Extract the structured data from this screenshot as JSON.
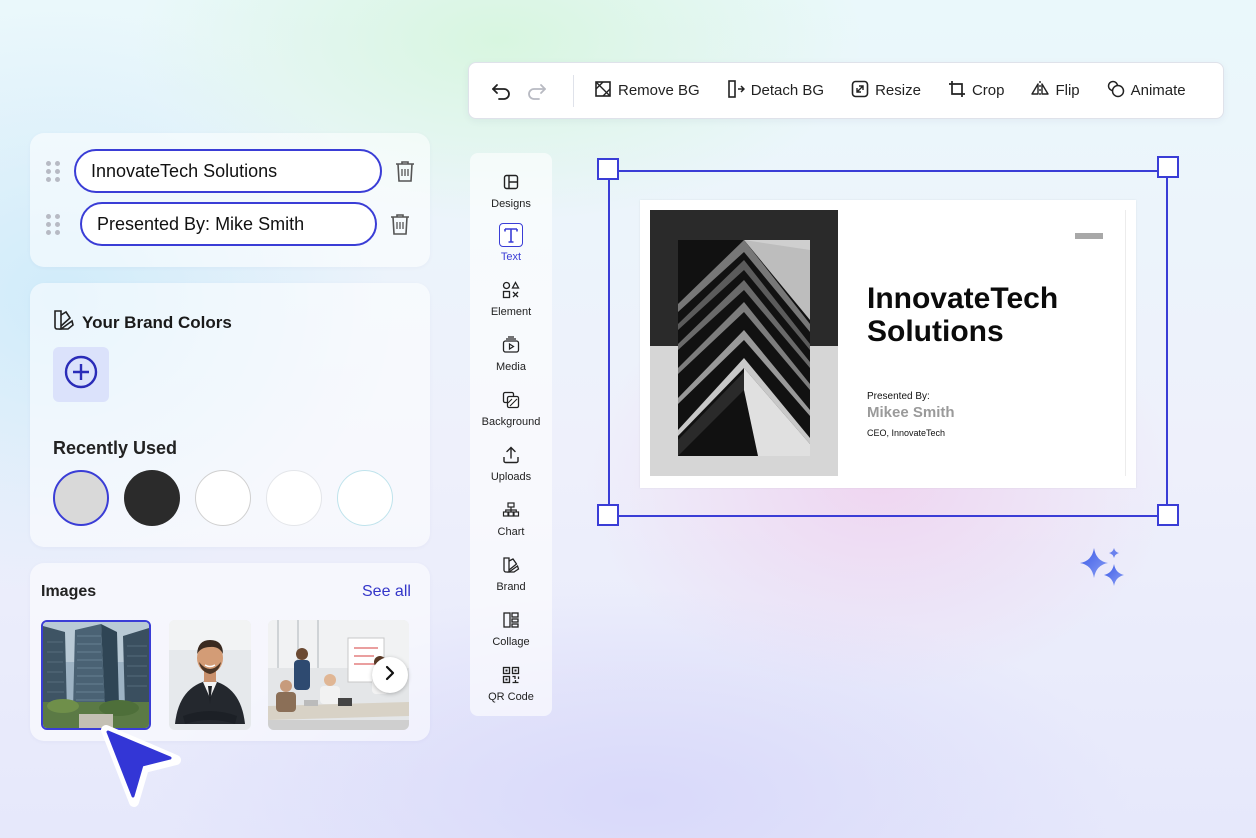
{
  "toolbar": {
    "undo_icon": "undo-icon",
    "redo_icon": "redo-icon",
    "buttons": [
      {
        "label": "Remove BG",
        "icon": "remove-bg-icon"
      },
      {
        "label": "Detach BG",
        "icon": "detach-bg-icon"
      },
      {
        "label": "Resize",
        "icon": "resize-icon"
      },
      {
        "label": "Crop",
        "icon": "crop-icon"
      },
      {
        "label": "Flip",
        "icon": "flip-icon"
      },
      {
        "label": "Animate",
        "icon": "animate-icon"
      }
    ]
  },
  "text_layers": [
    {
      "value": "InnovateTech Solutions"
    },
    {
      "value": "Presented By: Mike Smith"
    }
  ],
  "brand": {
    "title": "Your Brand Colors",
    "add_icon": "plus-circle-icon",
    "recent_title": "Recently Used",
    "recent_colors": [
      "#d9d9d9",
      "#2b2b2b",
      "#ffffff",
      "#ffffff",
      "#ffffff"
    ]
  },
  "images": {
    "title": "Images",
    "see_all": "See all",
    "thumbnails": [
      "office-building",
      "business-man",
      "team-meeting"
    ]
  },
  "side_menu": [
    {
      "label": "Designs",
      "icon": "layout-icon"
    },
    {
      "label": "Text",
      "icon": "text-icon",
      "active": true
    },
    {
      "label": "Element",
      "icon": "shapes-icon"
    },
    {
      "label": "Media",
      "icon": "media-icon"
    },
    {
      "label": "Background",
      "icon": "background-icon"
    },
    {
      "label": "Uploads",
      "icon": "upload-icon"
    },
    {
      "label": "Chart",
      "icon": "chart-icon"
    },
    {
      "label": "Brand",
      "icon": "brand-icon"
    },
    {
      "label": "Collage",
      "icon": "collage-icon"
    },
    {
      "label": "QR Code",
      "icon": "qr-code-icon"
    }
  ],
  "slide": {
    "title_line1": "InnovateTech",
    "title_line2": "Solutions",
    "presented_by": "Presented By:",
    "name": "Mikee Smith",
    "role": "CEO, InnovateTech"
  },
  "colors": {
    "accent": "#3a3dd6",
    "link": "#3436c9"
  }
}
